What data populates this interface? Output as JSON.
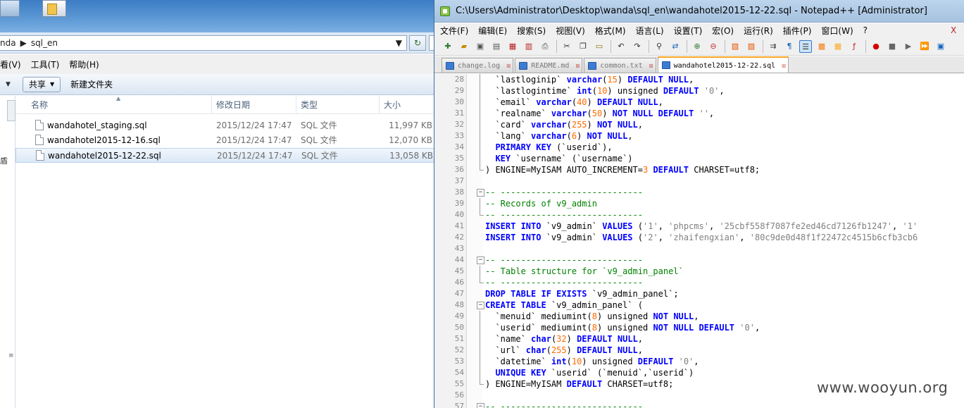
{
  "explorer": {
    "desktop_icons": [
      "",
      ""
    ],
    "desktop_icon_label": "",
    "address": {
      "crumbs": [
        "nda",
        "sql_en"
      ],
      "refresh_symbol": "↻"
    },
    "menu": [
      "看(V)",
      "工具(T)",
      "帮助(H)"
    ],
    "commands": {
      "share": "共享",
      "new_folder": "新建文件夹"
    },
    "columns": {
      "name": "名称",
      "date": "修改日期",
      "type": "类型",
      "size": "大小"
    },
    "nav_glyph": "盾",
    "files": [
      {
        "name": "wandahotel_staging.sql",
        "date": "2015/12/24 17:47",
        "type": "SQL 文件",
        "size": "11,997 KB",
        "selected": false
      },
      {
        "name": "wandahotel2015-12-16.sql",
        "date": "2015/12/24 17:47",
        "type": "SQL 文件",
        "size": "12,070 KB",
        "selected": false
      },
      {
        "name": "wandahotel2015-12-22.sql",
        "date": "2015/12/24 17:47",
        "type": "SQL 文件",
        "size": "13,058 KB",
        "selected": true
      }
    ]
  },
  "npp": {
    "title": "C:\\Users\\Administrator\\Desktop\\wanda\\sql_en\\wandahotel2015-12-22.sql - Notepad++ [Administrator]",
    "menu": [
      "文件(F)",
      "编辑(E)",
      "搜索(S)",
      "视图(V)",
      "格式(M)",
      "语言(L)",
      "设置(T)",
      "宏(O)",
      "运行(R)",
      "插件(P)",
      "窗口(W)",
      "?"
    ],
    "close_glyph": "X",
    "tabs": [
      {
        "label": "change.log",
        "active": false
      },
      {
        "label": "README.md",
        "active": false
      },
      {
        "label": "common.txt",
        "active": false
      },
      {
        "label": "wandahotel2015-12-22.sql",
        "active": true
      }
    ],
    "lines": [
      {
        "n": "28",
        "fold": "bar",
        "tokens": [
          [
            "  `lastloginip` ",
            "pun"
          ],
          [
            "varchar",
            "kw"
          ],
          [
            "(",
            "pun"
          ],
          [
            "15",
            "num"
          ],
          [
            ") ",
            "pun"
          ],
          [
            "DEFAULT NULL",
            "kw"
          ],
          [
            ",",
            "pun"
          ]
        ]
      },
      {
        "n": "29",
        "fold": "bar",
        "tokens": [
          [
            "  `lastlogintime` ",
            "pun"
          ],
          [
            "int",
            "kw"
          ],
          [
            "(",
            "pun"
          ],
          [
            "10",
            "num"
          ],
          [
            ") unsigned ",
            "pun"
          ],
          [
            "DEFAULT",
            "kw"
          ],
          [
            " ",
            "pun"
          ],
          [
            "'0'",
            "str"
          ],
          [
            ",",
            "pun"
          ]
        ]
      },
      {
        "n": "30",
        "fold": "bar",
        "tokens": [
          [
            "  `email` ",
            "pun"
          ],
          [
            "varchar",
            "kw"
          ],
          [
            "(",
            "pun"
          ],
          [
            "40",
            "num"
          ],
          [
            ") ",
            "pun"
          ],
          [
            "DEFAULT NULL",
            "kw"
          ],
          [
            ",",
            "pun"
          ]
        ]
      },
      {
        "n": "31",
        "fold": "bar",
        "tokens": [
          [
            "  `realname` ",
            "pun"
          ],
          [
            "varchar",
            "kw"
          ],
          [
            "(",
            "pun"
          ],
          [
            "50",
            "num"
          ],
          [
            ") ",
            "pun"
          ],
          [
            "NOT NULL DEFAULT",
            "kw"
          ],
          [
            " ",
            "pun"
          ],
          [
            "''",
            "str"
          ],
          [
            ",",
            "pun"
          ]
        ]
      },
      {
        "n": "32",
        "fold": "bar",
        "tokens": [
          [
            "  `card` ",
            "pun"
          ],
          [
            "varchar",
            "kw"
          ],
          [
            "(",
            "pun"
          ],
          [
            "255",
            "num"
          ],
          [
            ") ",
            "pun"
          ],
          [
            "NOT NULL",
            "kw"
          ],
          [
            ",",
            "pun"
          ]
        ]
      },
      {
        "n": "33",
        "fold": "bar",
        "tokens": [
          [
            "  `lang` ",
            "pun"
          ],
          [
            "varchar",
            "kw"
          ],
          [
            "(",
            "pun"
          ],
          [
            "6",
            "num"
          ],
          [
            ") ",
            "pun"
          ],
          [
            "NOT NULL",
            "kw"
          ],
          [
            ",",
            "pun"
          ]
        ]
      },
      {
        "n": "34",
        "fold": "bar",
        "tokens": [
          [
            "  ",
            "pun"
          ],
          [
            "PRIMARY KEY",
            "kw"
          ],
          [
            " (`userid`),",
            "pun"
          ]
        ]
      },
      {
        "n": "35",
        "fold": "bar",
        "tokens": [
          [
            "  ",
            "pun"
          ],
          [
            "KEY",
            "kw"
          ],
          [
            " `username` (`username`)",
            "pun"
          ]
        ]
      },
      {
        "n": "36",
        "fold": "end",
        "tokens": [
          [
            ") ENGINE=MyISAM AUTO_INCREMENT=",
            "pun"
          ],
          [
            "3",
            "num"
          ],
          [
            " ",
            "pun"
          ],
          [
            "DEFAULT",
            "kw"
          ],
          [
            " CHARSET=utf8;",
            "pun"
          ]
        ]
      },
      {
        "n": "37",
        "fold": "",
        "tokens": []
      },
      {
        "n": "38",
        "fold": "box",
        "tokens": [
          [
            "-- ----------------------------",
            "cmt"
          ]
        ]
      },
      {
        "n": "39",
        "fold": "bar",
        "tokens": [
          [
            "-- Records of v9_admin",
            "cmt"
          ]
        ]
      },
      {
        "n": "40",
        "fold": "end",
        "tokens": [
          [
            "-- ----------------------------",
            "cmt"
          ]
        ]
      },
      {
        "n": "41",
        "fold": "",
        "tokens": [
          [
            "INSERT INTO",
            "kw"
          ],
          [
            " `v9_admin` ",
            "pun"
          ],
          [
            "VALUES",
            "kw"
          ],
          [
            " (",
            "pun"
          ],
          [
            "'1'",
            "str"
          ],
          [
            ", ",
            "pun"
          ],
          [
            "'phpcms'",
            "str"
          ],
          [
            ", ",
            "pun"
          ],
          [
            "'25cbf558f7087fe2ed46cd7126fb1247'",
            "str"
          ],
          [
            ", ",
            "pun"
          ],
          [
            "'1'",
            "str"
          ]
        ]
      },
      {
        "n": "42",
        "fold": "",
        "tokens": [
          [
            "INSERT INTO",
            "kw"
          ],
          [
            " `v9_admin` ",
            "pun"
          ],
          [
            "VALUES",
            "kw"
          ],
          [
            " (",
            "pun"
          ],
          [
            "'2'",
            "str"
          ],
          [
            ", ",
            "pun"
          ],
          [
            "'zhaifengxian'",
            "str"
          ],
          [
            ", ",
            "pun"
          ],
          [
            "'80c9de0d48f1f22472c4515b6cfb3cb6",
            "str"
          ]
        ]
      },
      {
        "n": "43",
        "fold": "",
        "tokens": []
      },
      {
        "n": "44",
        "fold": "box",
        "tokens": [
          [
            "-- ----------------------------",
            "cmt"
          ]
        ]
      },
      {
        "n": "45",
        "fold": "bar",
        "tokens": [
          [
            "-- Table structure for `v9_admin_panel`",
            "cmt"
          ]
        ]
      },
      {
        "n": "46",
        "fold": "end",
        "tokens": [
          [
            "-- ----------------------------",
            "cmt"
          ]
        ]
      },
      {
        "n": "47",
        "fold": "",
        "tokens": [
          [
            "DROP TABLE IF EXISTS",
            "kw"
          ],
          [
            " `v9_admin_panel`;",
            "pun"
          ]
        ]
      },
      {
        "n": "48",
        "fold": "box",
        "tokens": [
          [
            "CREATE TABLE",
            "kw"
          ],
          [
            " `v9_admin_panel` (",
            "pun"
          ]
        ]
      },
      {
        "n": "49",
        "fold": "bar",
        "tokens": [
          [
            "  `menuid` mediumint(",
            "pun"
          ],
          [
            "8",
            "num"
          ],
          [
            ") unsigned ",
            "pun"
          ],
          [
            "NOT NULL",
            "kw"
          ],
          [
            ",",
            "pun"
          ]
        ]
      },
      {
        "n": "50",
        "fold": "bar",
        "tokens": [
          [
            "  `userid` mediumint(",
            "pun"
          ],
          [
            "8",
            "num"
          ],
          [
            ") unsigned ",
            "pun"
          ],
          [
            "NOT NULL DEFAULT",
            "kw"
          ],
          [
            " ",
            "pun"
          ],
          [
            "'0'",
            "str"
          ],
          [
            ",",
            "pun"
          ]
        ]
      },
      {
        "n": "51",
        "fold": "bar",
        "tokens": [
          [
            "  `name` ",
            "pun"
          ],
          [
            "char",
            "kw"
          ],
          [
            "(",
            "pun"
          ],
          [
            "32",
            "num"
          ],
          [
            ") ",
            "pun"
          ],
          [
            "DEFAULT NULL",
            "kw"
          ],
          [
            ",",
            "pun"
          ]
        ]
      },
      {
        "n": "52",
        "fold": "bar",
        "tokens": [
          [
            "  `url` ",
            "pun"
          ],
          [
            "char",
            "kw"
          ],
          [
            "(",
            "pun"
          ],
          [
            "255",
            "num"
          ],
          [
            ") ",
            "pun"
          ],
          [
            "DEFAULT NULL",
            "kw"
          ],
          [
            ",",
            "pun"
          ]
        ]
      },
      {
        "n": "53",
        "fold": "bar",
        "tokens": [
          [
            "  `datetime` ",
            "pun"
          ],
          [
            "int",
            "kw"
          ],
          [
            "(",
            "pun"
          ],
          [
            "10",
            "num"
          ],
          [
            ") unsigned ",
            "pun"
          ],
          [
            "DEFAULT",
            "kw"
          ],
          [
            " ",
            "pun"
          ],
          [
            "'0'",
            "str"
          ],
          [
            ",",
            "pun"
          ]
        ]
      },
      {
        "n": "54",
        "fold": "bar",
        "tokens": [
          [
            "  ",
            "pun"
          ],
          [
            "UNIQUE KEY",
            "kw"
          ],
          [
            " `userid` (`menuid`,`userid`)",
            "pun"
          ]
        ]
      },
      {
        "n": "55",
        "fold": "end",
        "tokens": [
          [
            ") ENGINE=MyISAM ",
            "pun"
          ],
          [
            "DEFAULT",
            "kw"
          ],
          [
            " CHARSET=utf8;",
            "pun"
          ]
        ]
      },
      {
        "n": "56",
        "fold": "",
        "tokens": []
      },
      {
        "n": "57",
        "fold": "box",
        "tokens": [
          [
            "-- ----------------------------",
            "cmt"
          ]
        ]
      }
    ]
  },
  "watermark": "www.wooyun.org"
}
